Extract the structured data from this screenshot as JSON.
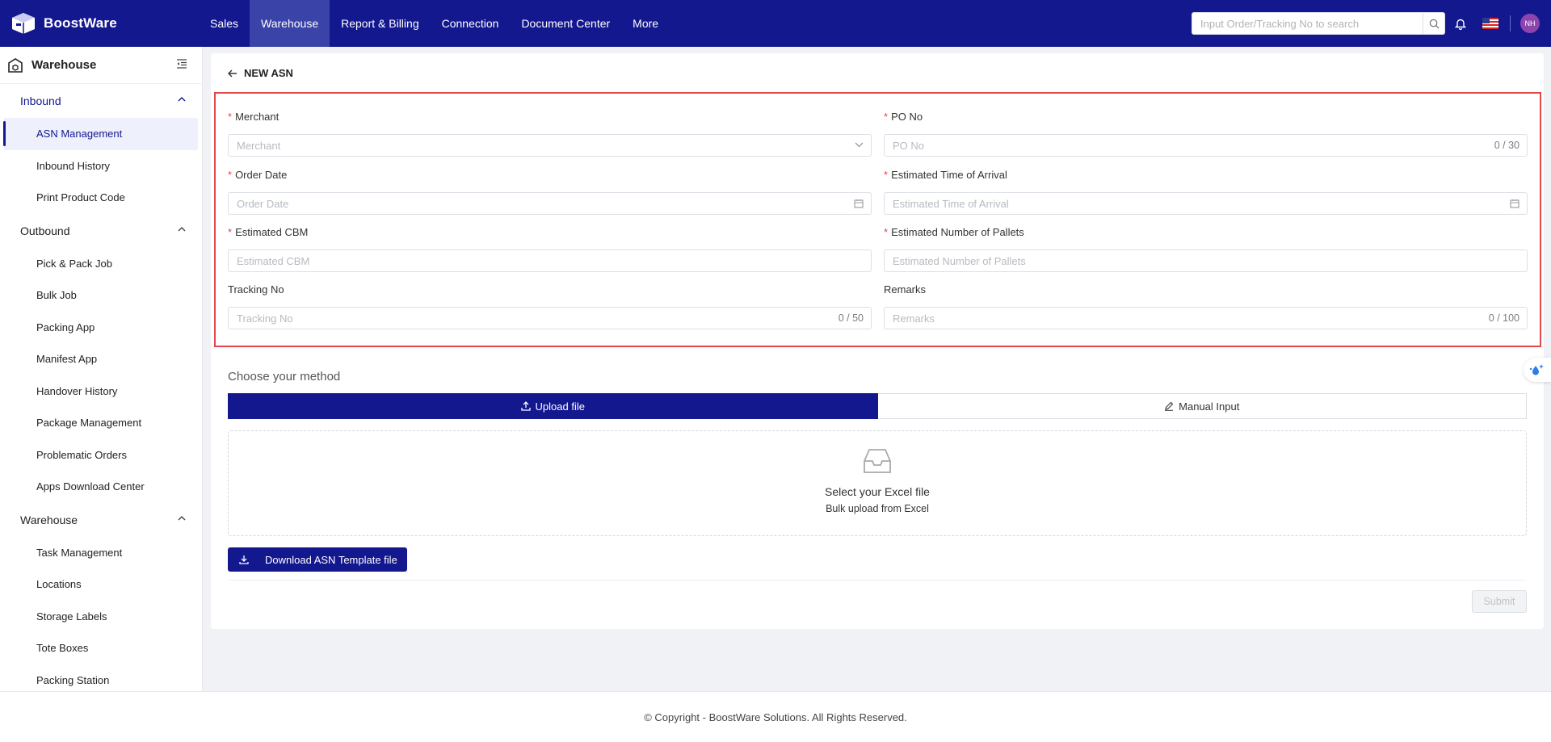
{
  "brand": {
    "name": "BoostWare"
  },
  "nav": {
    "items": [
      {
        "label": "Sales"
      },
      {
        "label": "Warehouse",
        "active": true
      },
      {
        "label": "Report & Billing"
      },
      {
        "label": "Connection"
      },
      {
        "label": "Document Center"
      },
      {
        "label": "More"
      }
    ],
    "search_placeholder": "Input Order/Tracking No to search",
    "avatar_initials": "NH"
  },
  "sidebar": {
    "title": "Warehouse",
    "sections": [
      {
        "label": "Inbound",
        "items": [
          "ASN Management",
          "Inbound History",
          "Print Product Code"
        ]
      },
      {
        "label": "Outbound",
        "items": [
          "Pick & Pack Job",
          "Bulk Job",
          "Packing App",
          "Manifest App",
          "Handover History",
          "Package Management",
          "Problematic Orders",
          "Apps Download Center"
        ]
      },
      {
        "label": "Warehouse",
        "items": [
          "Task Management",
          "Locations",
          "Storage Labels",
          "Tote Boxes",
          "Packing Station"
        ]
      }
    ]
  },
  "page": {
    "title": "NEW ASN",
    "fields": {
      "merchant": {
        "label": "Merchant",
        "placeholder": "Merchant"
      },
      "po_no": {
        "label": "PO No",
        "placeholder": "PO No",
        "counter": "0 / 30"
      },
      "order_date": {
        "label": "Order Date",
        "placeholder": "Order Date"
      },
      "eta": {
        "label": "Estimated Time of Arrival",
        "placeholder": "Estimated Time of Arrival"
      },
      "cbm": {
        "label": "Estimated CBM",
        "placeholder": "Estimated CBM"
      },
      "pallets": {
        "label": "Estimated Number of Pallets",
        "placeholder": "Estimated Number of Pallets"
      },
      "tracking": {
        "label": "Tracking No",
        "placeholder": "Tracking No",
        "counter": "0 / 50"
      },
      "remarks": {
        "label": "Remarks",
        "placeholder": "Remarks",
        "counter": "0 / 100"
      }
    },
    "choose_method": "Choose your method",
    "method_upload": "Upload file",
    "method_manual": "Manual Input",
    "drop_title": "Select your Excel file",
    "drop_subtitle": "Bulk upload from Excel",
    "download_label": "Download ASN Template file",
    "submit_label": "Submit"
  },
  "footer": {
    "copyright": "© Copyright - BoostWare Solutions. All Rights Reserved."
  },
  "colors": {
    "primary": "#13188f",
    "highlight_border": "#e4474b",
    "required": "#e4474b"
  }
}
